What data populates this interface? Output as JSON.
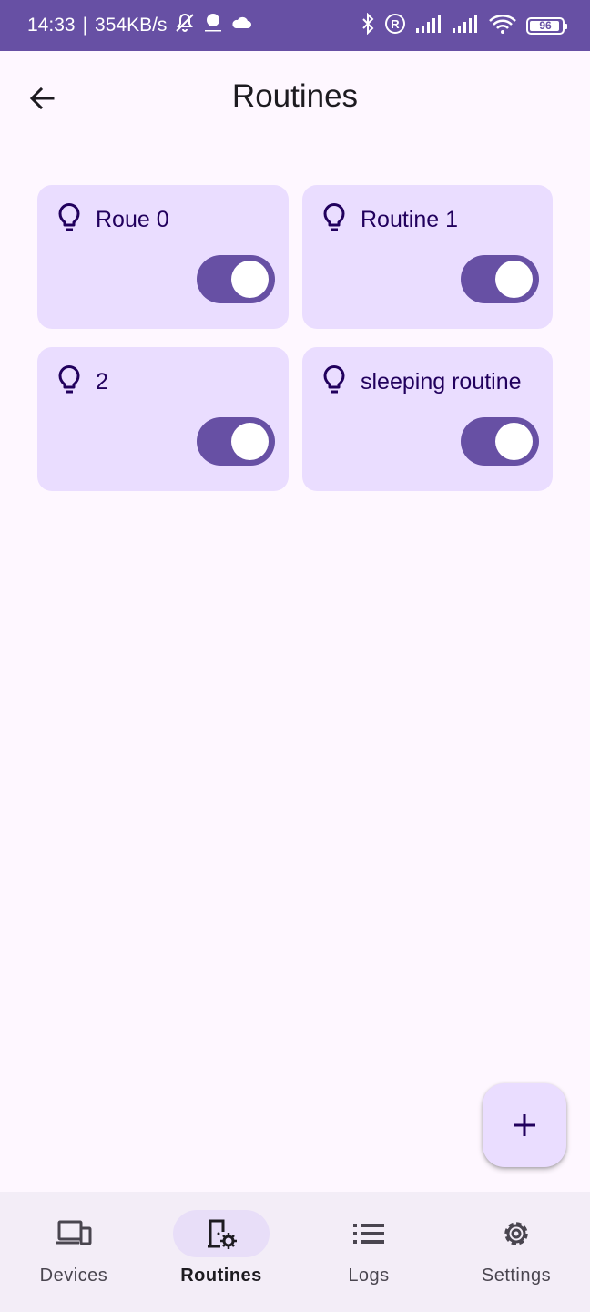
{
  "status_bar": {
    "time": "14:33",
    "separator": "|",
    "speed": "354KB/s",
    "battery": "96",
    "battery_level": 0.96,
    "icons": [
      "mute-bell-icon",
      "dot-icon",
      "cloud-icon",
      "bluetooth-icon",
      "registered-icon",
      "signal-icon",
      "signal-icon",
      "wifi-icon",
      "battery-icon"
    ]
  },
  "header": {
    "title": "Routines",
    "back_icon": "arrow-back-icon"
  },
  "routines": [
    {
      "name": "Roue 0",
      "icon": "lightbulb-icon",
      "enabled": true
    },
    {
      "name": "Routine 1",
      "icon": "lightbulb-icon",
      "enabled": true
    },
    {
      "name": "2",
      "icon": "lightbulb-icon",
      "enabled": true
    },
    {
      "name": "sleeping routine",
      "icon": "lightbulb-icon",
      "enabled": true
    }
  ],
  "fab": {
    "icon": "plus-icon"
  },
  "nav": {
    "items": [
      {
        "label": "Devices",
        "icon": "devices-icon",
        "active": false
      },
      {
        "label": "Routines",
        "icon": "routine-settings-icon",
        "active": true
      },
      {
        "label": "Logs",
        "icon": "list-icon",
        "active": false
      },
      {
        "label": "Settings",
        "icon": "gear-icon",
        "active": false
      }
    ]
  },
  "colors": {
    "primary": "#6750A4",
    "card": "#EADDFF",
    "on_card": "#21005D",
    "background": "#FEF7FF",
    "nav_background": "#F3EDF7",
    "nav_indicator": "#E8DEF8"
  }
}
